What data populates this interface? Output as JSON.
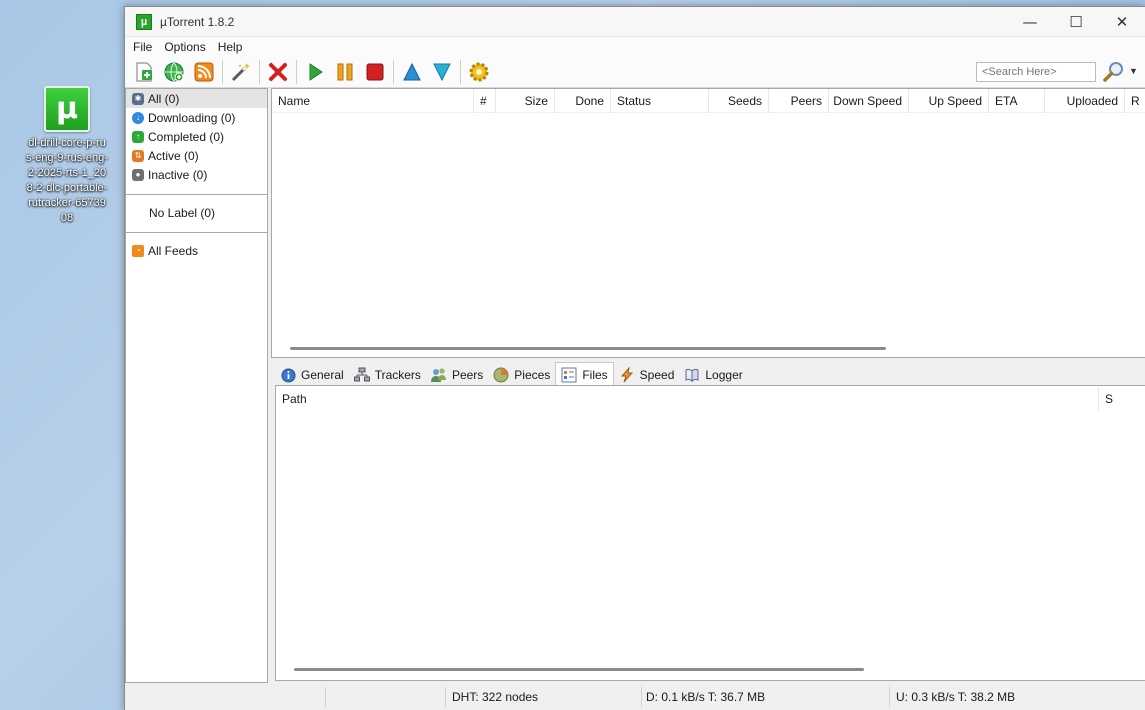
{
  "desktop": {
    "icon_label": "dl-drill-core-p-rus-eng-9-rus-eng-2-2025-rts-1_208-2-dlc-portable-rutracker-6573908"
  },
  "window": {
    "title": "µTorrent 1.8.2",
    "controls": {
      "minimize": "—",
      "maximize": "☐",
      "close": "✕"
    }
  },
  "menu": [
    "File",
    "Options",
    "Help"
  ],
  "search": {
    "placeholder": "<Search Here>"
  },
  "sidebar": {
    "categories": [
      {
        "label": "All (0)",
        "icon": "all-icon",
        "color": "#5a6f8f"
      },
      {
        "label": "Downloading (0)",
        "icon": "downloading-icon",
        "color": "#2d8ae0"
      },
      {
        "label": "Completed (0)",
        "icon": "completed-icon",
        "color": "#2fa83a"
      },
      {
        "label": "Active (0)",
        "icon": "active-icon",
        "color": "#e07a1f"
      },
      {
        "label": "Inactive (0)",
        "icon": "inactive-icon",
        "color": "#6f6f6f"
      }
    ],
    "no_label": "No Label (0)",
    "feeds": "All Feeds"
  },
  "list": {
    "columns": [
      "Name",
      "#",
      "Size",
      "Done",
      "Status",
      "Seeds",
      "Peers",
      "Down Speed",
      "Up Speed",
      "ETA",
      "Uploaded",
      "R"
    ]
  },
  "tabs": [
    "General",
    "Trackers",
    "Peers",
    "Pieces",
    "Files",
    "Speed",
    "Logger"
  ],
  "active_tab": "Files",
  "files": {
    "columns": [
      "Path",
      "S"
    ]
  },
  "status": {
    "dht": "DHT: 322 nodes",
    "download": "D: 0.1 kB/s T: 36.7 MB",
    "upload": "U: 0.3 kB/s T: 38.2 MB"
  },
  "colors": {
    "accent_green": "#2aa52a",
    "remove_red": "#d32020",
    "queue_blue": "#2a8fd6"
  }
}
